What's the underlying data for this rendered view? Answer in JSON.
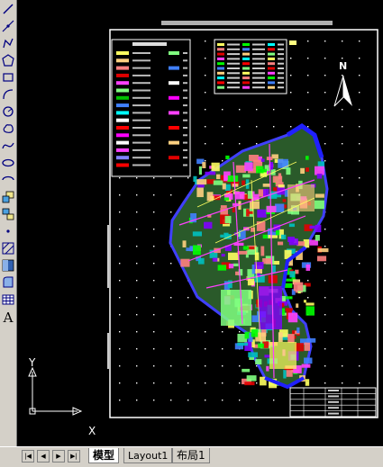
{
  "toolbar": {
    "tools": [
      {
        "icon": "line-icon"
      },
      {
        "icon": "construction-line-icon"
      },
      {
        "icon": "polyline-icon"
      },
      {
        "icon": "polygon-icon"
      },
      {
        "icon": "rectangle-icon"
      },
      {
        "icon": "arc-icon"
      },
      {
        "icon": "circle-icon"
      },
      {
        "icon": "revision-cloud-icon"
      },
      {
        "icon": "spline-icon"
      },
      {
        "icon": "ellipse-icon"
      },
      {
        "icon": "ellipse-arc-icon"
      },
      {
        "icon": "insert-block-icon"
      },
      {
        "icon": "make-block-icon"
      },
      {
        "icon": "point-icon"
      },
      {
        "icon": "hatch-icon"
      },
      {
        "icon": "gradient-icon"
      },
      {
        "icon": "region-icon"
      },
      {
        "icon": "table-icon"
      },
      {
        "icon": "multiline-text-icon"
      }
    ],
    "text_tool_label": "A"
  },
  "ucs": {
    "x_label": "X",
    "y_label": "Y"
  },
  "drawing": {
    "north_label": "N"
  },
  "layout_tabs": {
    "tabs": [
      {
        "label": "模型",
        "active": true
      },
      {
        "label": "Layout1",
        "active": false
      },
      {
        "label": "布局1",
        "active": false
      }
    ]
  },
  "colors": {
    "canvas": "#000000",
    "chrome": "#d4d0c8",
    "frame": "#ffffff"
  }
}
